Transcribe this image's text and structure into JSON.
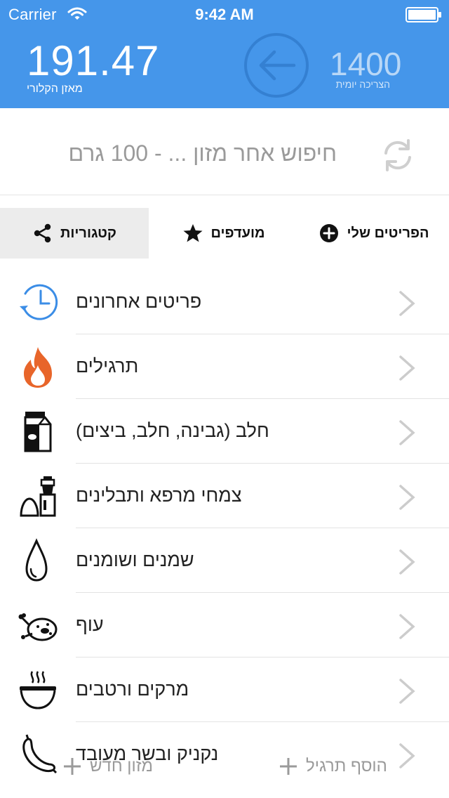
{
  "status_bar": {
    "carrier": "Carrier",
    "time": "9:42 AM"
  },
  "balance": {
    "value": "191.47",
    "label": "מאזן הקלורי"
  },
  "daily": {
    "value": "1400",
    "label": "הצריכה יומית"
  },
  "search": {
    "placeholder": "חיפוש אחר מזון ... - 100 גרם"
  },
  "tabs": [
    {
      "label": "קטגוריות",
      "icon": "share-icon",
      "selected": true
    },
    {
      "label": "מועדפים",
      "icon": "star-icon",
      "selected": false
    },
    {
      "label": "הפריטים שלי",
      "icon": "plus-circle-icon",
      "selected": false
    }
  ],
  "categories": [
    {
      "label": "פריטים אחרונים",
      "icon": "history-clock-icon"
    },
    {
      "label": "תרגילים",
      "icon": "flame-icon"
    },
    {
      "label": "חלב (גבינה, חלב, ביצים)",
      "icon": "milk-carton-icon"
    },
    {
      "label": "צמחי מרפא ותבלינים",
      "icon": "spice-grinder-icon"
    },
    {
      "label": "שמנים ושומנים",
      "icon": "oil-drop-icon"
    },
    {
      "label": "עוף",
      "icon": "roast-chicken-icon"
    },
    {
      "label": "מרקים ורטבים",
      "icon": "soup-bowl-icon"
    },
    {
      "label": "נקניק ובשר מעובד",
      "icon": "sausage-icon"
    }
  ],
  "actions": {
    "add_exercise": "הוסף תרגיל",
    "add_food": "מזון חדש"
  },
  "colors": {
    "header_bg": "#4596ea",
    "accent_orange": "#e8652a",
    "clock_blue": "#3b8de6"
  }
}
